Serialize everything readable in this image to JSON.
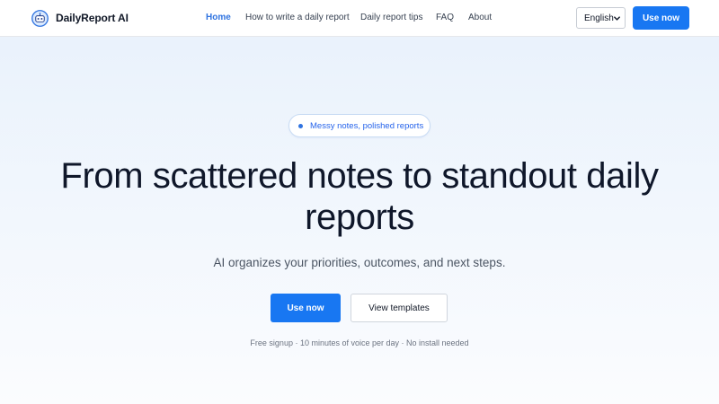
{
  "brand": {
    "name": "DailyReport AI",
    "logo_icon": "robot-logo-icon"
  },
  "nav": {
    "items": [
      {
        "label": "Home",
        "active": true
      },
      {
        "label": "How to write a daily report",
        "active": false
      },
      {
        "label": "Daily report tips",
        "active": false
      },
      {
        "label": "FAQ",
        "active": false
      },
      {
        "label": "About",
        "active": false
      }
    ]
  },
  "language_select": {
    "value": "English"
  },
  "header_cta": {
    "label": "Use now"
  },
  "hero": {
    "badge": "Messy notes, polished reports",
    "headline": "From scattered notes to standout daily reports",
    "subheadline": "AI organizes your priorities, outcomes, and next steps.",
    "primary_cta": "Use now",
    "secondary_cta": "View templates",
    "note": "Free signup · 10 minutes of voice per day · No install needed"
  },
  "colors": {
    "accent": "#1877f2",
    "nav_active": "#2f73e0",
    "background_top": "#e8f1fc",
    "text": "#0f172a"
  }
}
